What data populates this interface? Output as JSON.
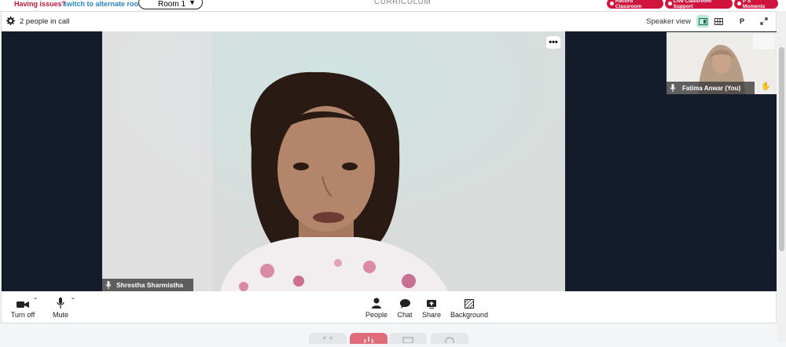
{
  "topbar": {
    "issues_text": "Having issues?",
    "alternate_link": "switch to alternate room",
    "room_label": "Room 1",
    "curriculum": "CURRICULUM",
    "buttons": [
      {
        "label": "Record Classroom"
      },
      {
        "label": "Live Classroom Support"
      },
      {
        "label": "P S Moments"
      }
    ],
    "accent_color": "#d0143e"
  },
  "call_header": {
    "people_count": "2 people in call",
    "view_mode": "Speaker view",
    "view_buttons": [
      {
        "icon": "speaker-layout-icon"
      },
      {
        "icon": "grid-layout-icon"
      },
      {
        "label": "P"
      },
      {
        "icon": "fullscreen-icon"
      }
    ]
  },
  "main_video": {
    "participant": "Shrestha Sharmistha",
    "more_label": "•••"
  },
  "self_view": {
    "participant": "Fatima Anwar (You)"
  },
  "toolbar": {
    "camera_label": "Turn off",
    "mute_label": "Mute",
    "people_label": "People",
    "chat_label": "Chat",
    "share_label": "Share",
    "background_label": "Background"
  }
}
